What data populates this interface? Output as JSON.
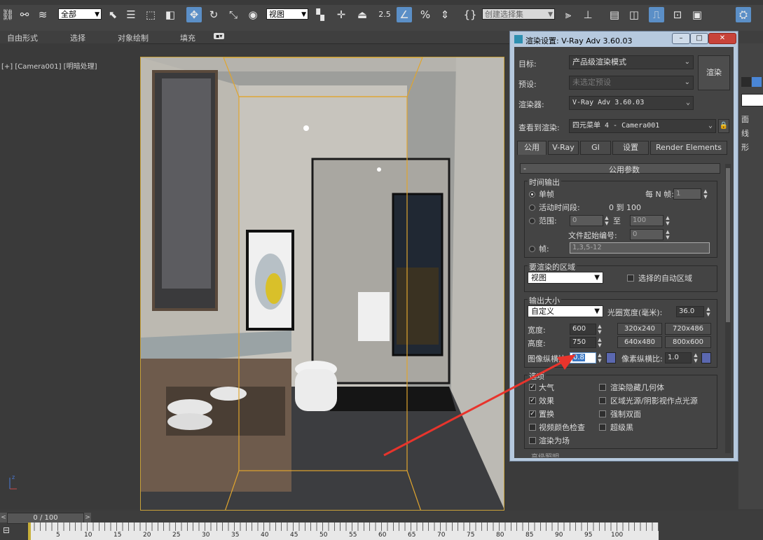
{
  "toolbar": {
    "selection_filter": "全部",
    "ref_coord": "视图",
    "angle_snap": "2.5",
    "named_selection": "创建选择集"
  },
  "ribbon": {
    "items": [
      "自由形式",
      "选择",
      "对象绘制",
      "填充"
    ]
  },
  "viewport": {
    "label": "[+] [Camera001] [明暗处理]"
  },
  "timeline": {
    "frame_counter": "0 / 100",
    "ticks": [
      "5",
      "10",
      "15",
      "20",
      "25",
      "30",
      "35",
      "40",
      "45",
      "50",
      "55",
      "60",
      "65",
      "70",
      "75",
      "80",
      "85",
      "90",
      "95",
      "100"
    ]
  },
  "dialog": {
    "title": "渲染设置: V-Ray Adv 3.60.03",
    "target_label": "目标:",
    "target_value": "产品级渲染模式",
    "preset_label": "预设:",
    "preset_value": "未选定预设",
    "renderer_label": "渲染器:",
    "renderer_value": "V-Ray Adv 3.60.03",
    "view_label": "查看到渲染:",
    "view_value": "四元菜单 4 - Camera001",
    "render_button": "渲染",
    "tabs": [
      "公用",
      "V-Ray",
      "GI",
      "设置",
      "Render Elements"
    ],
    "rollout_title": "公用参数",
    "time_output": {
      "title": "时间输出",
      "single": "单帧",
      "every_n_label": "每 N 帧:",
      "every_n_value": "1",
      "active_segment": "活动时间段:",
      "active_range": "0 到 100",
      "range": "范围:",
      "range_start": "0",
      "range_to": "至",
      "range_end": "100",
      "file_start_label": "文件起始编号:",
      "file_start_value": "0",
      "frames": "帧:",
      "frames_value": "1,3,5-12"
    },
    "area": {
      "title": "要渲染的区域",
      "value": "视图",
      "auto_region": "选择的自动区域"
    },
    "output_size": {
      "title": "输出大小",
      "preset": "自定义",
      "aperture_label": "光圈宽度(毫米):",
      "aperture_value": "36.0",
      "width_label": "宽度:",
      "width_value": "600",
      "height_label": "高度:",
      "height_value": "750",
      "res_buttons": [
        "320x240",
        "720x486",
        "640x480",
        "800x600"
      ],
      "aspect_label": "图像纵横比:",
      "aspect_value": "0.8",
      "pixel_aspect_label": "像素纵横比:",
      "pixel_aspect_value": "1.0"
    },
    "options": {
      "title": "选项",
      "items": [
        {
          "label": "大气",
          "checked": "✓"
        },
        {
          "label": "渲染隐藏几何体",
          "checked": ""
        },
        {
          "label": "效果",
          "checked": "✓"
        },
        {
          "label": "区域光源/阴影视作点光源",
          "checked": ""
        },
        {
          "label": "置换",
          "checked": "✓"
        },
        {
          "label": "强制双面",
          "checked": ""
        },
        {
          "label": "视频颜色检查",
          "checked": ""
        },
        {
          "label": "超级黑",
          "checked": ""
        },
        {
          "label": "渲染为场",
          "checked": ""
        }
      ]
    },
    "next_section": "高级照明"
  },
  "right_panel": {
    "labels": [
      "面",
      "线",
      "形"
    ]
  }
}
